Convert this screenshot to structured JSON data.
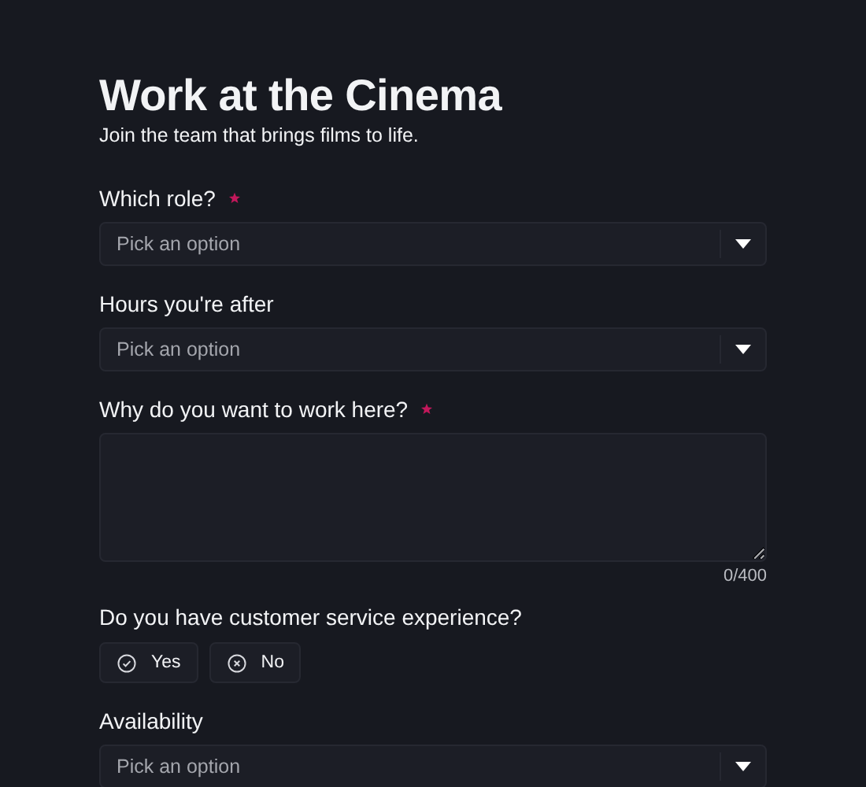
{
  "title": "Work at the Cinema",
  "subtitle": "Join the team that brings films to life.",
  "fields": [
    {
      "kind": "select",
      "label": "Which role?",
      "required": true,
      "placeholder": "Pick an option"
    },
    {
      "kind": "select",
      "label": "Hours you're after",
      "required": false,
      "placeholder": "Pick an option"
    },
    {
      "kind": "textarea",
      "label": "Why do you want to work here?",
      "required": true,
      "counter": "0/400"
    },
    {
      "kind": "choice",
      "label": "Do you have customer service experience?",
      "required": false,
      "options": [
        {
          "label": "Yes",
          "selected": false
        },
        {
          "label": "No",
          "selected": false
        }
      ]
    },
    {
      "kind": "select",
      "label": "Availability",
      "required": false,
      "placeholder": "Pick an option"
    }
  ]
}
